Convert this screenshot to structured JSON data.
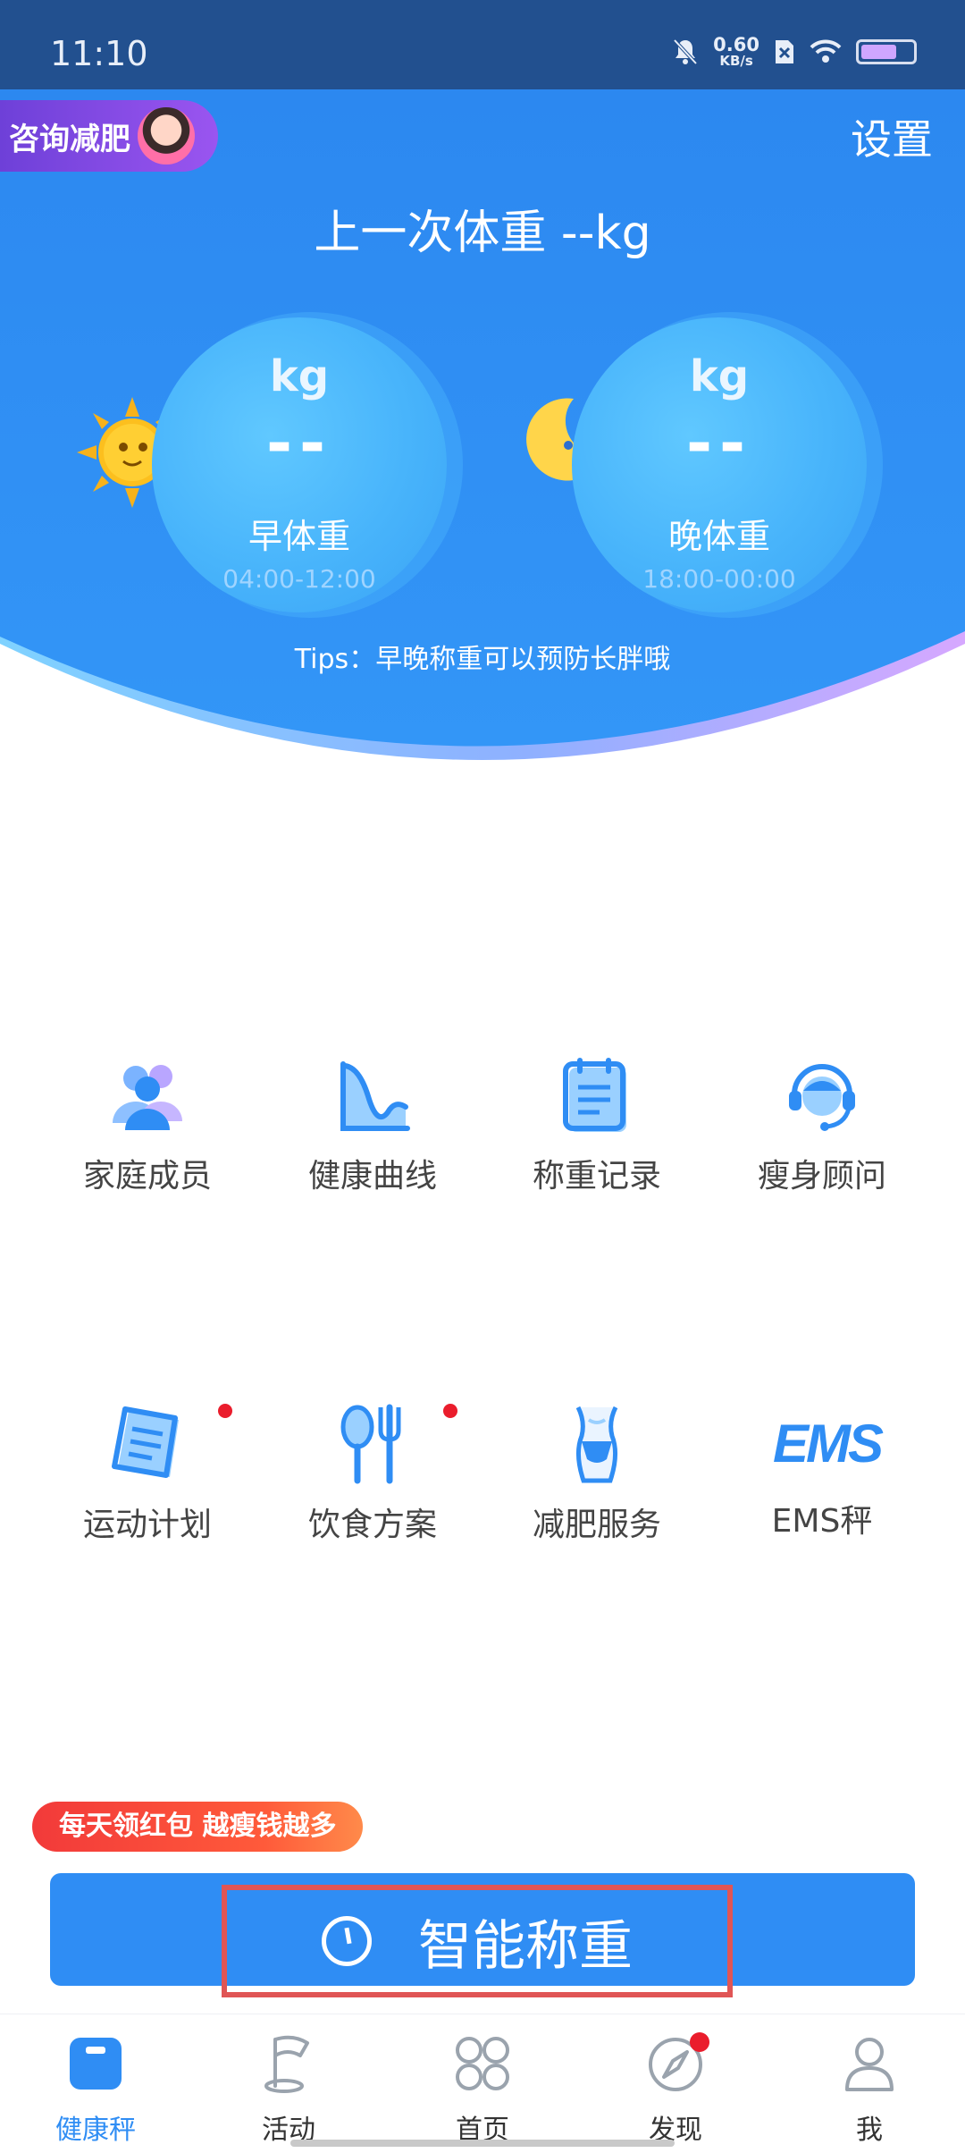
{
  "status_bar": {
    "time": "11:10",
    "net_speed_value": "0.60",
    "net_speed_unit": "KB/s",
    "icons": [
      "bell-off-icon",
      "sim-x-icon",
      "wifi-icon",
      "battery-icon"
    ]
  },
  "header": {
    "consult_label": "咨询减肥",
    "settings_label": "设置",
    "last_weight": "上一次体重 --kg",
    "tips": "Tips：早晚称重可以预防长胖哦"
  },
  "morning": {
    "unit": "kg",
    "value": "--",
    "name": "早体重",
    "range": "04:00-12:00",
    "icon": "sun-icon"
  },
  "evening": {
    "unit": "kg",
    "value": "--",
    "name": "晚体重",
    "range": "18:00-00:00",
    "icon": "moon-icon"
  },
  "grid": {
    "row1": [
      {
        "label": "家庭成员",
        "icon": "family-members-icon"
      },
      {
        "label": "健康曲线",
        "icon": "health-curve-icon"
      },
      {
        "label": "称重记录",
        "icon": "weigh-record-icon"
      },
      {
        "label": "瘦身顾问",
        "icon": "slimming-advisor-icon"
      }
    ],
    "row2": [
      {
        "label": "运动计划",
        "icon": "exercise-plan-icon",
        "badge": true
      },
      {
        "label": "饮食方案",
        "icon": "diet-plan-icon",
        "badge": true
      },
      {
        "label": "减肥服务",
        "icon": "weight-loss-service-icon"
      },
      {
        "label": "EMS秤",
        "icon": "ems-scale-icon",
        "icon_text": "EMS"
      }
    ]
  },
  "promo": {
    "text": "每天领红包  越瘦钱越多"
  },
  "weigh_button": {
    "label": "智能称重",
    "icon": "clock-icon"
  },
  "bottom_nav": {
    "items": [
      {
        "label": "健康秤",
        "icon": "scale-icon",
        "active": true
      },
      {
        "label": "活动",
        "icon": "flag-icon"
      },
      {
        "label": "首页",
        "icon": "grid-icon"
      },
      {
        "label": "发现",
        "icon": "compass-icon",
        "badge": true
      },
      {
        "label": "我",
        "icon": "person-icon"
      }
    ]
  },
  "colors": {
    "primary": "#2f8df4",
    "header_blue": "#2e8cf2",
    "status_bar": "#22508f",
    "badge_red": "#ea1d2c",
    "promo_red": "#f23a3a",
    "consult_purple": "#7b46e0"
  }
}
